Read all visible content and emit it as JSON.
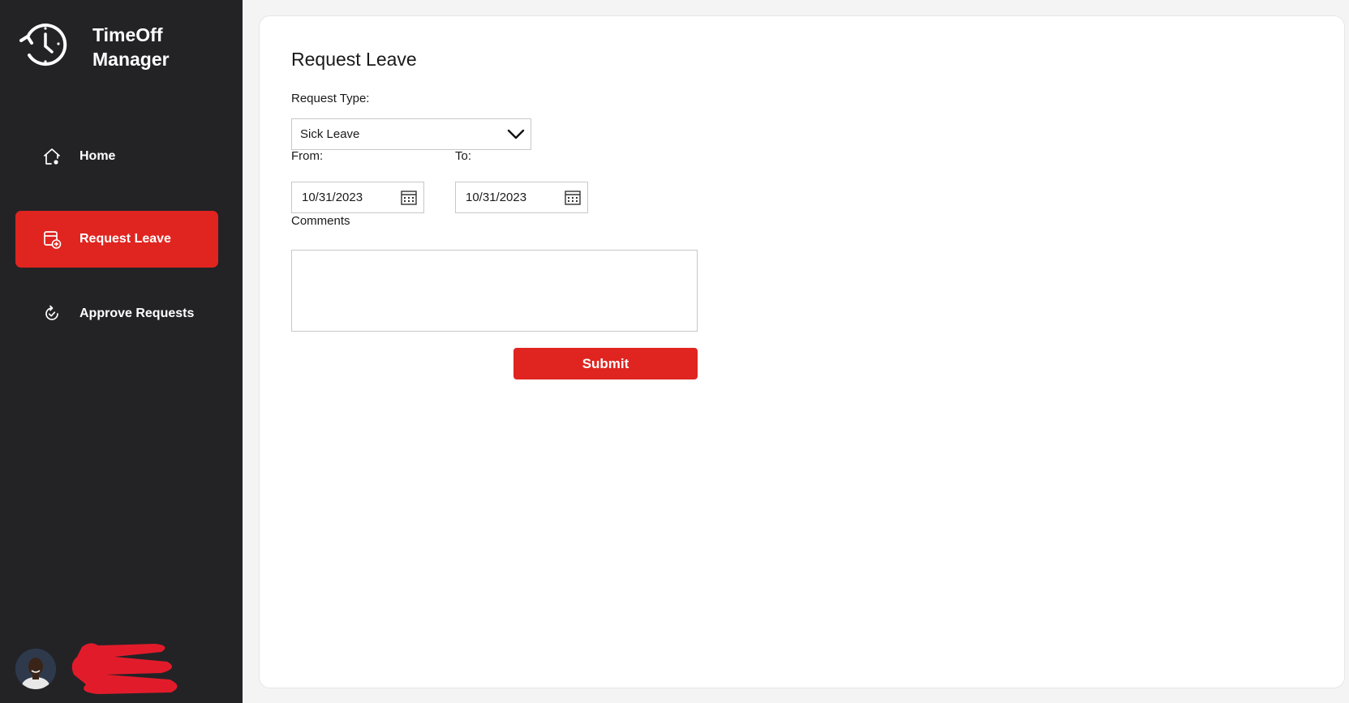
{
  "app": {
    "title": "TimeOff Manager"
  },
  "sidebar": {
    "items": [
      {
        "label": "Home",
        "icon": "home-icon",
        "active": false
      },
      {
        "label": "Request Leave",
        "icon": "calendar-add-icon",
        "active": true
      },
      {
        "label": "Approve Requests",
        "icon": "refresh-check-icon",
        "active": false
      }
    ],
    "user": {
      "avatar": "avatar",
      "name_redacted": true
    }
  },
  "form": {
    "title": "Request Leave",
    "request_type_label": "Request Type:",
    "request_type_value": "Sick Leave",
    "from_label": "From:",
    "from_value": "10/31/2023",
    "to_label": "To:",
    "to_value": "10/31/2023",
    "comments_label": "Comments",
    "comments_value": "",
    "submit_label": "Submit"
  },
  "colors": {
    "sidebar_bg": "#232326",
    "accent": "#e02520",
    "page_bg": "#f4f4f4",
    "card_bg": "#ffffff"
  }
}
